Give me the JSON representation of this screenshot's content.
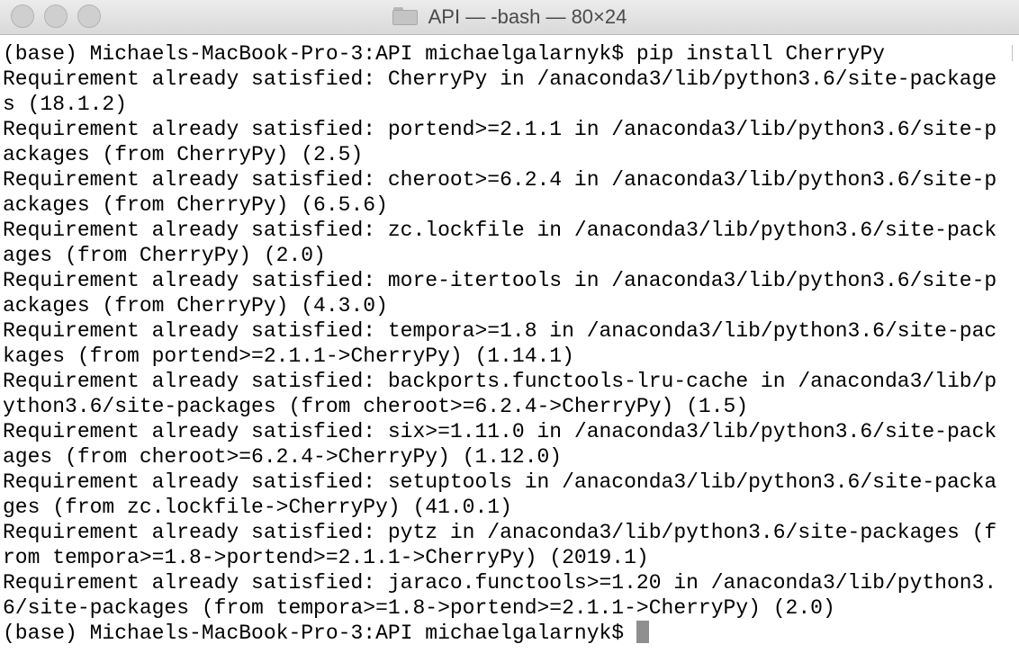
{
  "window": {
    "title": "API — -bash — 80×24",
    "folder_icon": "folder-icon",
    "buttons": [
      "close-button",
      "minimize-button",
      "zoom-button"
    ]
  },
  "terminal": {
    "lines": [
      "(base) Michaels-MacBook-Pro-3:API michaelgalarnyk$ pip install CherryPy",
      "Requirement already satisfied: CherryPy in /anaconda3/lib/python3.6/site-package",
      "s (18.1.2)",
      "Requirement already satisfied: portend>=2.1.1 in /anaconda3/lib/python3.6/site-p",
      "ackages (from CherryPy) (2.5)",
      "Requirement already satisfied: cheroot>=6.2.4 in /anaconda3/lib/python3.6/site-p",
      "ackages (from CherryPy) (6.5.6)",
      "Requirement already satisfied: zc.lockfile in /anaconda3/lib/python3.6/site-pack",
      "ages (from CherryPy) (2.0)",
      "Requirement already satisfied: more-itertools in /anaconda3/lib/python3.6/site-p",
      "ackages (from CherryPy) (4.3.0)",
      "Requirement already satisfied: tempora>=1.8 in /anaconda3/lib/python3.6/site-pac",
      "kages (from portend>=2.1.1->CherryPy) (1.14.1)",
      "Requirement already satisfied: backports.functools-lru-cache in /anaconda3/lib/p",
      "ython3.6/site-packages (from cheroot>=6.2.4->CherryPy) (1.5)",
      "Requirement already satisfied: six>=1.11.0 in /anaconda3/lib/python3.6/site-pack",
      "ages (from cheroot>=6.2.4->CherryPy) (1.12.0)",
      "Requirement already satisfied: setuptools in /anaconda3/lib/python3.6/site-packa",
      "ges (from zc.lockfile->CherryPy) (41.0.1)",
      "Requirement already satisfied: pytz in /anaconda3/lib/python3.6/site-packages (f",
      "rom tempora>=1.8->portend>=2.1.1->CherryPy) (2019.1)",
      "Requirement already satisfied: jaraco.functools>=1.20 in /anaconda3/lib/python3.",
      "6/site-packages (from tempora>=1.8->portend>=2.1.1->CherryPy) (2.0)"
    ],
    "prompt": "(base) Michaels-MacBook-Pro-3:API michaelgalarnyk$ "
  }
}
